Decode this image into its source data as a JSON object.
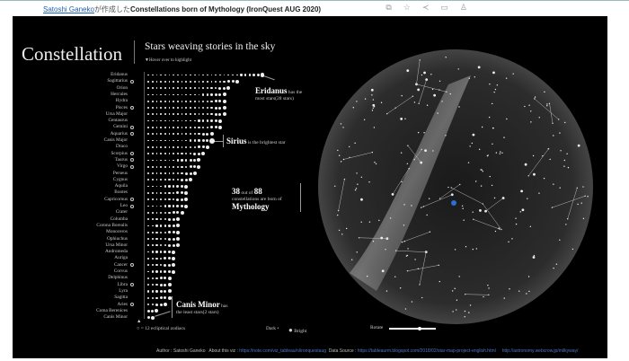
{
  "header": {
    "author": "Satoshi Ganeko",
    "made_by": "が作成した",
    "title": "Constellations born of Mythology (IronQuest AUG 2020)",
    "icons": [
      "copy-icon",
      "star-icon",
      "share-icon",
      "comment-icon",
      "award-icon"
    ]
  },
  "viz": {
    "title": "Constellation",
    "subtitle": "Stars weaving stories in the sky",
    "hint": "▼Hover over to highlight"
  },
  "constellations": [
    {
      "name": "Eridanus",
      "stars": 28,
      "zodiac": false
    },
    {
      "name": "Sagittarius",
      "stars": 22,
      "zodiac": true
    },
    {
      "name": "Orion",
      "stars": 20,
      "zodiac": false
    },
    {
      "name": "Hercules",
      "stars": 19,
      "zodiac": false
    },
    {
      "name": "Hydra",
      "stars": 19,
      "zodiac": false
    },
    {
      "name": "Pisces",
      "stars": 19,
      "zodiac": true
    },
    {
      "name": "Ursa Major",
      "stars": 19,
      "zodiac": false
    },
    {
      "name": "Centaurus",
      "stars": 18,
      "zodiac": false
    },
    {
      "name": "Gemini",
      "stars": 18,
      "zodiac": true
    },
    {
      "name": "Aquarius",
      "stars": 16,
      "zodiac": true
    },
    {
      "name": "Canis Major",
      "stars": 16,
      "zodiac": false
    },
    {
      "name": "Draco",
      "stars": 15,
      "zodiac": false
    },
    {
      "name": "Scorpius",
      "stars": 14,
      "zodiac": true
    },
    {
      "name": "Taurus",
      "stars": 13,
      "zodiac": true
    },
    {
      "name": "Virgo",
      "stars": 13,
      "zodiac": true
    },
    {
      "name": "Perseus",
      "stars": 12,
      "zodiac": false
    },
    {
      "name": "Cygnus",
      "stars": 11,
      "zodiac": false
    },
    {
      "name": "Aquila",
      "stars": 10,
      "zodiac": false
    },
    {
      "name": "Bootes",
      "stars": 10,
      "zodiac": false
    },
    {
      "name": "Capricornus",
      "stars": 10,
      "zodiac": true
    },
    {
      "name": "Leo",
      "stars": 10,
      "zodiac": true
    },
    {
      "name": "Crater",
      "stars": 9,
      "zodiac": false
    },
    {
      "name": "Columba",
      "stars": 8,
      "zodiac": false
    },
    {
      "name": "Corona Borealis",
      "stars": 8,
      "zodiac": false
    },
    {
      "name": "Monoceros",
      "stars": 8,
      "zodiac": false
    },
    {
      "name": "Ophiuchus",
      "stars": 8,
      "zodiac": false
    },
    {
      "name": "Ursa Minor",
      "stars": 8,
      "zodiac": false
    },
    {
      "name": "Andromeda",
      "stars": 7,
      "zodiac": false
    },
    {
      "name": "Auriga",
      "stars": 7,
      "zodiac": false
    },
    {
      "name": "Cancer",
      "stars": 7,
      "zodiac": true
    },
    {
      "name": "Corvus",
      "stars": 7,
      "zodiac": false
    },
    {
      "name": "Delphinus",
      "stars": 6,
      "zodiac": false
    },
    {
      "name": "Libra",
      "stars": 6,
      "zodiac": true
    },
    {
      "name": "Lyra",
      "stars": 6,
      "zodiac": false
    },
    {
      "name": "Sagitta",
      "stars": 6,
      "zodiac": false
    },
    {
      "name": "Aries",
      "stars": 5,
      "zodiac": true
    },
    {
      "name": "Coma Berenices",
      "stars": 3,
      "zodiac": false
    },
    {
      "name": "Canis Minor",
      "stars": 2,
      "zodiac": false
    }
  ],
  "annotations": {
    "eridanus": {
      "name": "Eridanus",
      "text1": "has the",
      "text2": "most stars(28 stars)"
    },
    "sirius": {
      "name": "Sirius",
      "text": "is the brightest star"
    },
    "mythology": {
      "count": "38",
      "outof": "out of",
      "total": "88",
      "text": "constellations are born of",
      "word": "Mythology"
    },
    "canisminor": {
      "name": "Canis Minor",
      "text1": "has",
      "text2": "the least stars(2 stars)"
    }
  },
  "legend": {
    "zodiac": "○ = 12 ecliptical zodiacs",
    "dark": "Dark",
    "bright": "Bright",
    "rotate": "Rotate"
  },
  "rotate_value": 0.65,
  "footer": {
    "author": "Author : Satoshi Ganeko",
    "about_label": "About this viz :",
    "about_url": "https://note.com/viz_tableau/n/ironquestaug",
    "source_label": "Data Source :",
    "source_url": "https://tableaurm.blogspot.com/2018/02/star-map-project-english.html",
    "source_url2": "http://astronomy.webcrow.jp/milkyway/"
  },
  "colors": {
    "background": "#000000",
    "accent_star": "#2a6fd6",
    "link": "#1a5fb4"
  }
}
